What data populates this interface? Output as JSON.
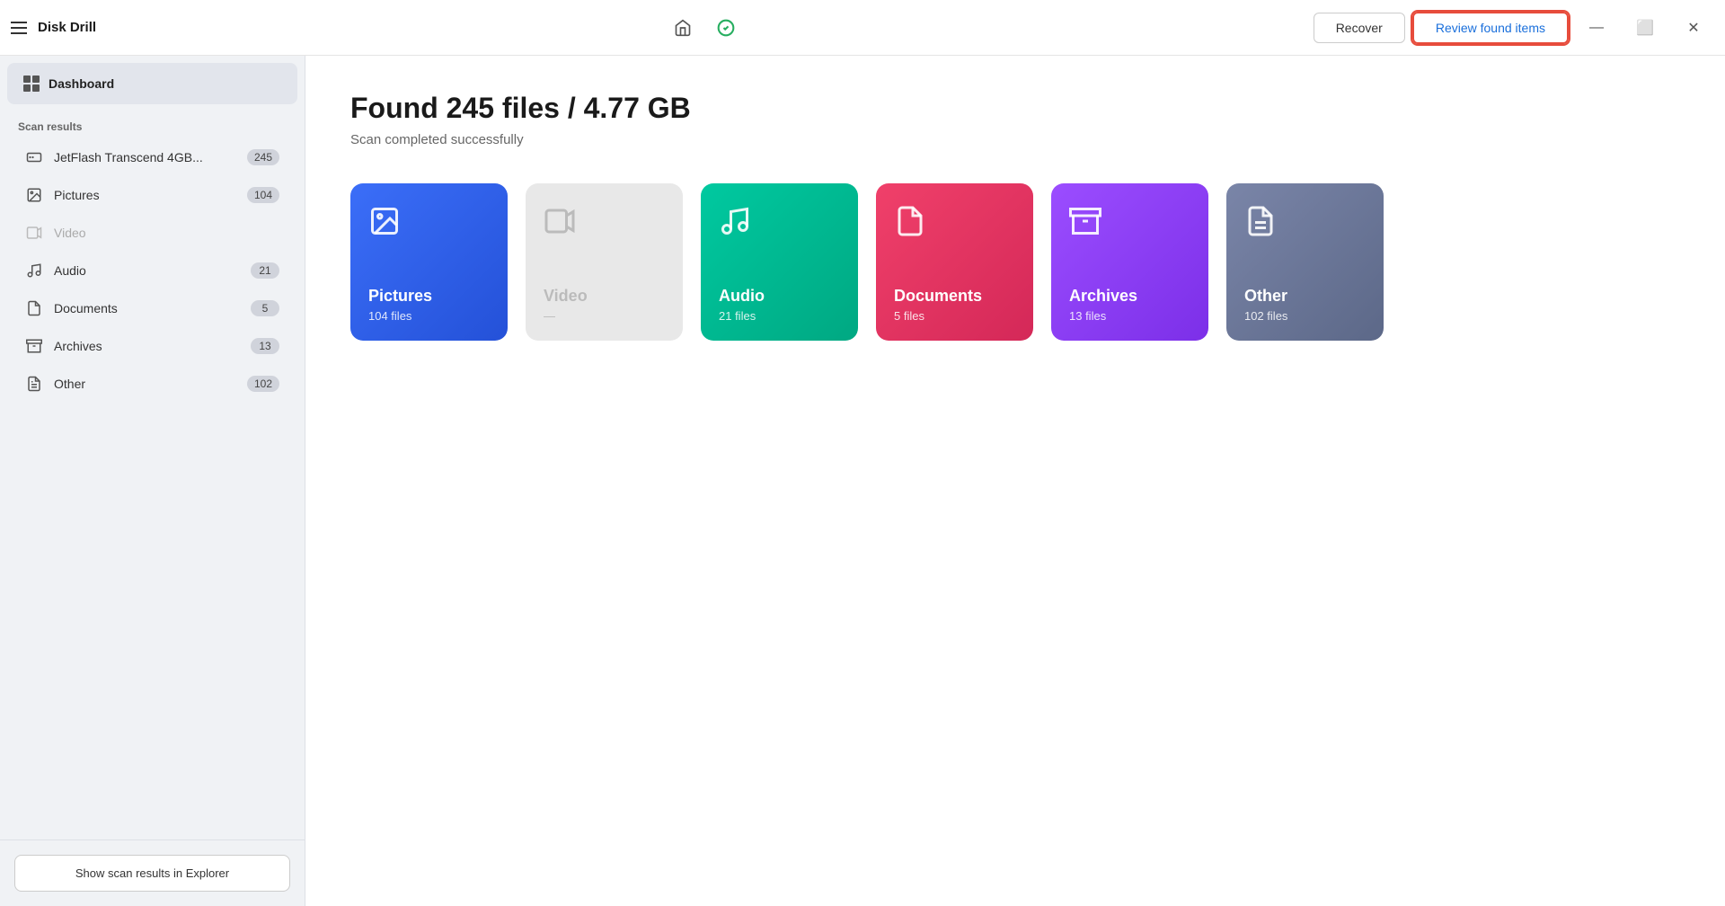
{
  "app": {
    "title": "Disk Drill",
    "window_controls": {
      "minimize": "—",
      "maximize": "⬜",
      "close": "✕"
    }
  },
  "header": {
    "recover_label": "Recover",
    "review_label": "Review found items"
  },
  "sidebar": {
    "dashboard_label": "Dashboard",
    "scan_results_label": "Scan results",
    "items": [
      {
        "id": "jetflash",
        "label": "JetFlash Transcend 4GB...",
        "count": "245",
        "dimmed": false
      },
      {
        "id": "pictures",
        "label": "Pictures",
        "count": "104",
        "dimmed": false
      },
      {
        "id": "video",
        "label": "Video",
        "count": "",
        "dimmed": true
      },
      {
        "id": "audio",
        "label": "Audio",
        "count": "21",
        "dimmed": false
      },
      {
        "id": "documents",
        "label": "Documents",
        "count": "5",
        "dimmed": false
      },
      {
        "id": "archives",
        "label": "Archives",
        "count": "13",
        "dimmed": false
      },
      {
        "id": "other",
        "label": "Other",
        "count": "102",
        "dimmed": false
      }
    ],
    "footer_button": "Show scan results in Explorer"
  },
  "main": {
    "found_title": "Found 245 files / 4.77 GB",
    "found_subtitle": "Scan completed successfully",
    "cards": [
      {
        "id": "pictures",
        "name": "Pictures",
        "count": "104 files",
        "style": "pictures"
      },
      {
        "id": "video",
        "name": "Video",
        "count": "—",
        "style": "video"
      },
      {
        "id": "audio",
        "name": "Audio",
        "count": "21 files",
        "style": "audio"
      },
      {
        "id": "documents",
        "name": "Documents",
        "count": "5 files",
        "style": "documents"
      },
      {
        "id": "archives",
        "name": "Archives",
        "count": "13 files",
        "style": "archives"
      },
      {
        "id": "other",
        "name": "Other",
        "count": "102 files",
        "style": "other"
      }
    ]
  }
}
